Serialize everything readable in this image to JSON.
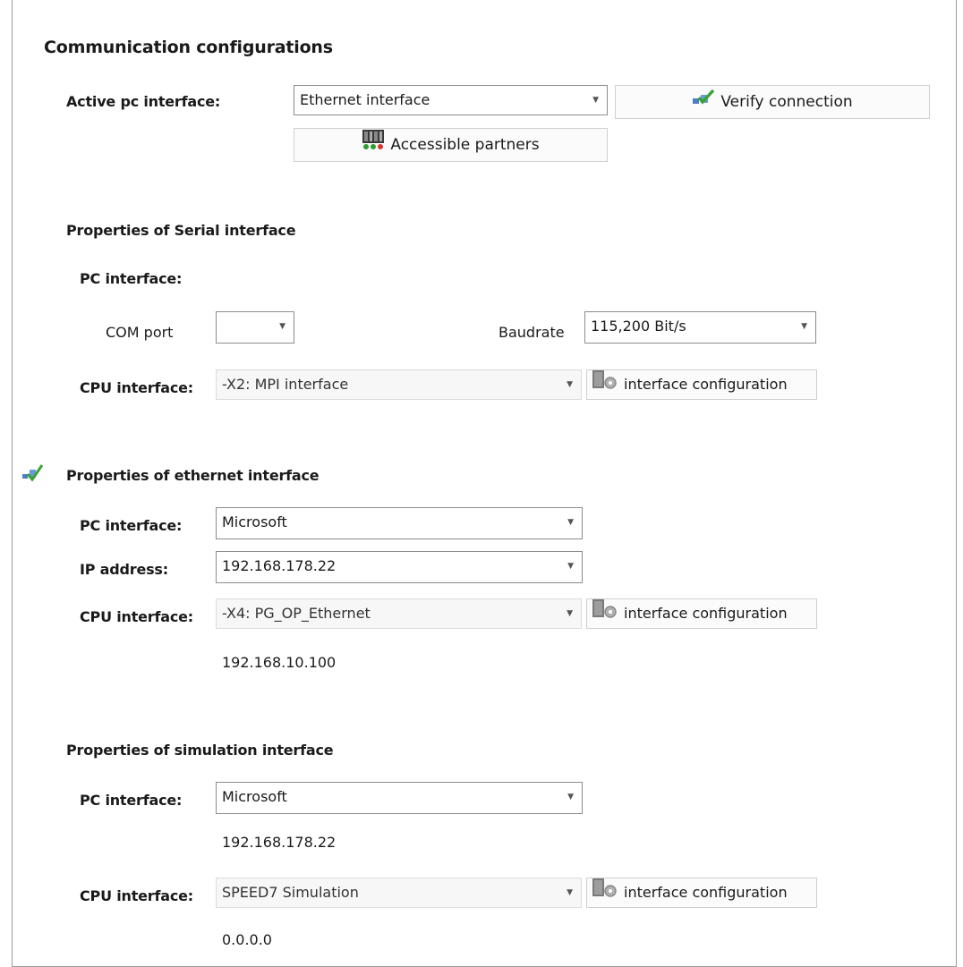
{
  "title": "Communication configurations",
  "active": {
    "label": "Active pc interface:",
    "value": "Ethernet interface",
    "verify_label": "Verify connection",
    "partners_label": "Accessible partners"
  },
  "serial": {
    "heading": "Properties of Serial interface",
    "pc_label": "PC interface:",
    "com_label": "COM port",
    "com_value": "",
    "baud_label": "Baudrate",
    "baud_value": "115,200 Bit/s",
    "cpu_label": "CPU interface:",
    "cpu_value": "-X2: MPI interface",
    "config_label": "interface configuration"
  },
  "ethernet": {
    "heading": "Properties of ethernet interface",
    "pc_label": "PC interface:",
    "pc_value": "Microsoft",
    "ip_label": "IP address:",
    "ip_value": "192.168.178.22",
    "cpu_label": "CPU interface:",
    "cpu_value": "-X4: PG_OP_Ethernet",
    "config_label": "interface configuration",
    "cpu_ip": "192.168.10.100"
  },
  "simulation": {
    "heading": "Properties of simulation interface",
    "pc_label": "PC interface:",
    "pc_value": "Microsoft",
    "pc_ip": "192.168.178.22",
    "cpu_label": "CPU interface:",
    "cpu_value": "SPEED7 Simulation",
    "config_label": "interface configuration",
    "cpu_ip": "0.0.0.0"
  },
  "icons": {
    "active_marker": "network-active-icon",
    "verify": "verify-connection-icon",
    "partners": "accessible-partners-icon",
    "config": "interface-config-icon"
  }
}
